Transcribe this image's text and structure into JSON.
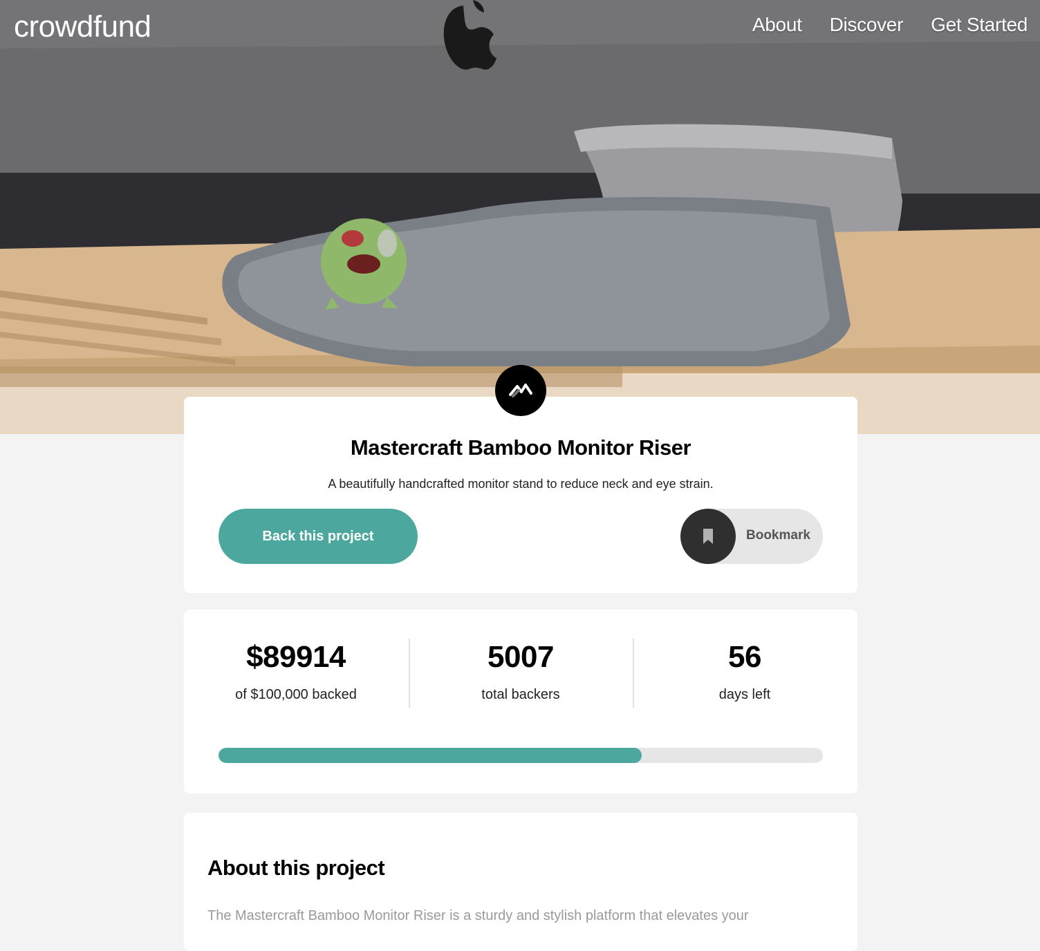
{
  "header": {
    "brand": "crowdfund",
    "nav": [
      "About",
      "Discover",
      "Get Started"
    ]
  },
  "project": {
    "logo_icon": "mastercraft-logo-icon",
    "title": "Mastercraft Bamboo Monitor Riser",
    "subtitle": "A beautifully handcrafted monitor stand to reduce neck and eye strain.",
    "back_label": "Back this project",
    "bookmark_label": "Bookmark",
    "bookmark_icon": "bookmark-icon"
  },
  "stats": {
    "backed_amount": "$89914",
    "backed_label": "of $100,000 backed",
    "backers": "5007",
    "backers_label": "total backers",
    "days": "56",
    "days_label": "days left",
    "progress": 0.7
  },
  "about": {
    "title": "About this project",
    "text": "The Mastercraft Bamboo Monitor Riser is a sturdy and stylish platform that elevates your"
  },
  "colors": {
    "accent": "#4ca89e",
    "dark": "#2f2f2f",
    "background": "#f3f3f3"
  }
}
